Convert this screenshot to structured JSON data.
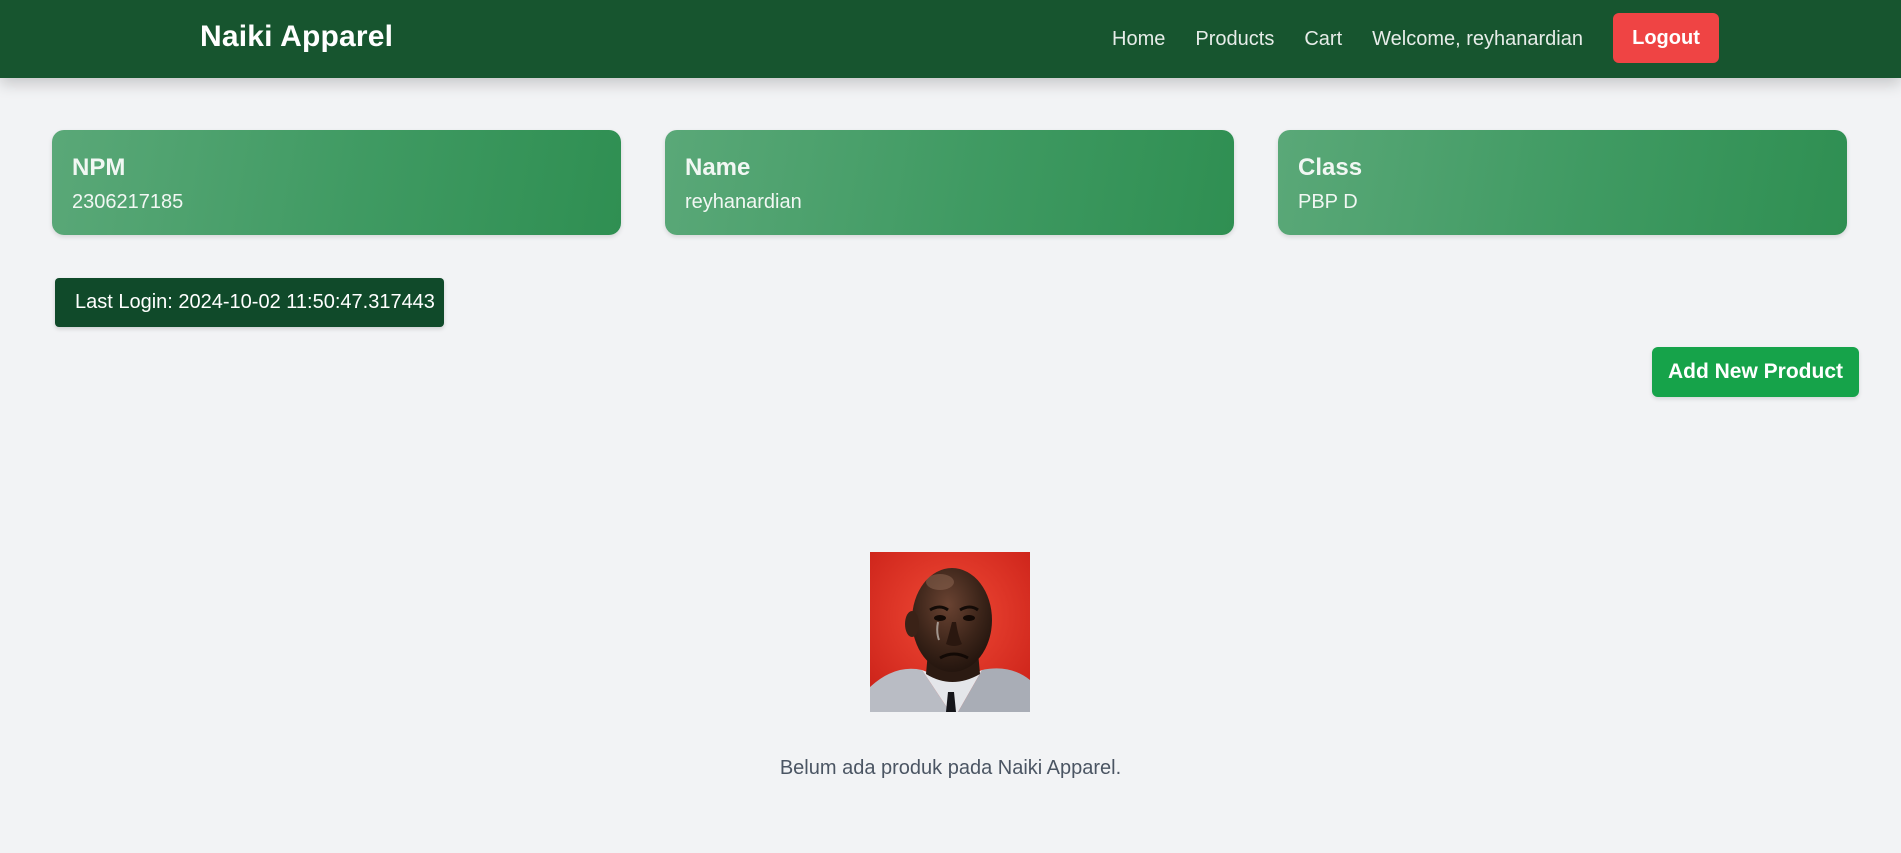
{
  "nav": {
    "brand": "Naiki Apparel",
    "links": [
      "Home",
      "Products",
      "Cart"
    ],
    "welcome": "Welcome, reyhanardian",
    "logout_label": "Logout"
  },
  "info_cards": [
    {
      "title": "NPM",
      "value": "2306217185"
    },
    {
      "title": "Name",
      "value": "reyhanardian"
    },
    {
      "title": "Class",
      "value": "PBP D"
    }
  ],
  "last_login": "Last Login: 2024-10-02 11:50:47.317443",
  "add_product_label": "Add New Product",
  "empty_state": {
    "image_icon": "sad-face-photo",
    "message": "Belum ada produk pada Naiki Apparel."
  },
  "colors": {
    "navbar": "#17552f",
    "logout": "#ef4444",
    "add_button": "#16a34a",
    "last_login_bg": "#104a2a"
  }
}
